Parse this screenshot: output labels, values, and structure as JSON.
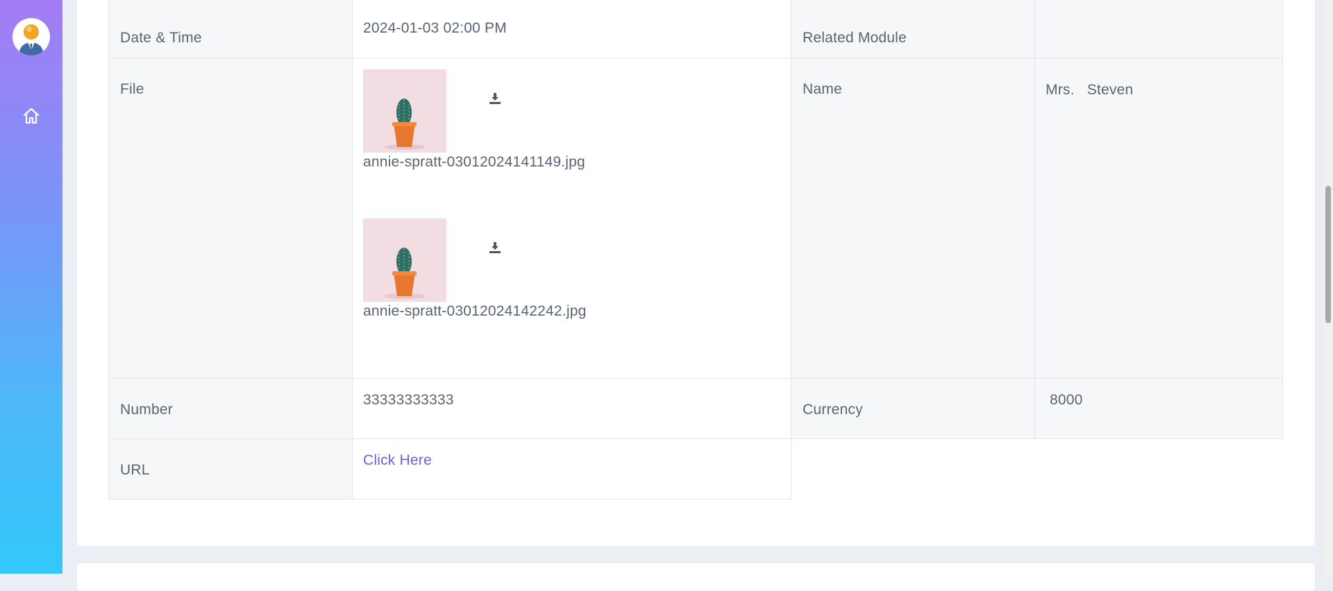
{
  "sidebar": {
    "avatar_icon": "user-avatar",
    "home_icon": "home-icon"
  },
  "details": {
    "date_time_label": "Date & Time",
    "date_time_value": "2024-01-03 02:00 PM",
    "related_module_label": "Related Module",
    "related_module_value": "",
    "file_label": "File",
    "files": [
      {
        "name": "annie-spratt-03012024141149.jpg",
        "icon": "download-icon"
      },
      {
        "name": "annie-spratt-03012024142242.jpg",
        "icon": "download-icon"
      }
    ],
    "name_label": "Name",
    "name_value": "Mrs.   Steven",
    "number_label": "Number",
    "number_value": "33333333333",
    "currency_label": "Currency",
    "currency_value": " 8000",
    "url_label": "URL",
    "url_value": "Click Here"
  },
  "colors": {
    "sidebar_top": "#a57cf5",
    "sidebar_bottom": "#33c8fb",
    "link": "#6a66d6",
    "label_bg": "#f6f7f9"
  }
}
